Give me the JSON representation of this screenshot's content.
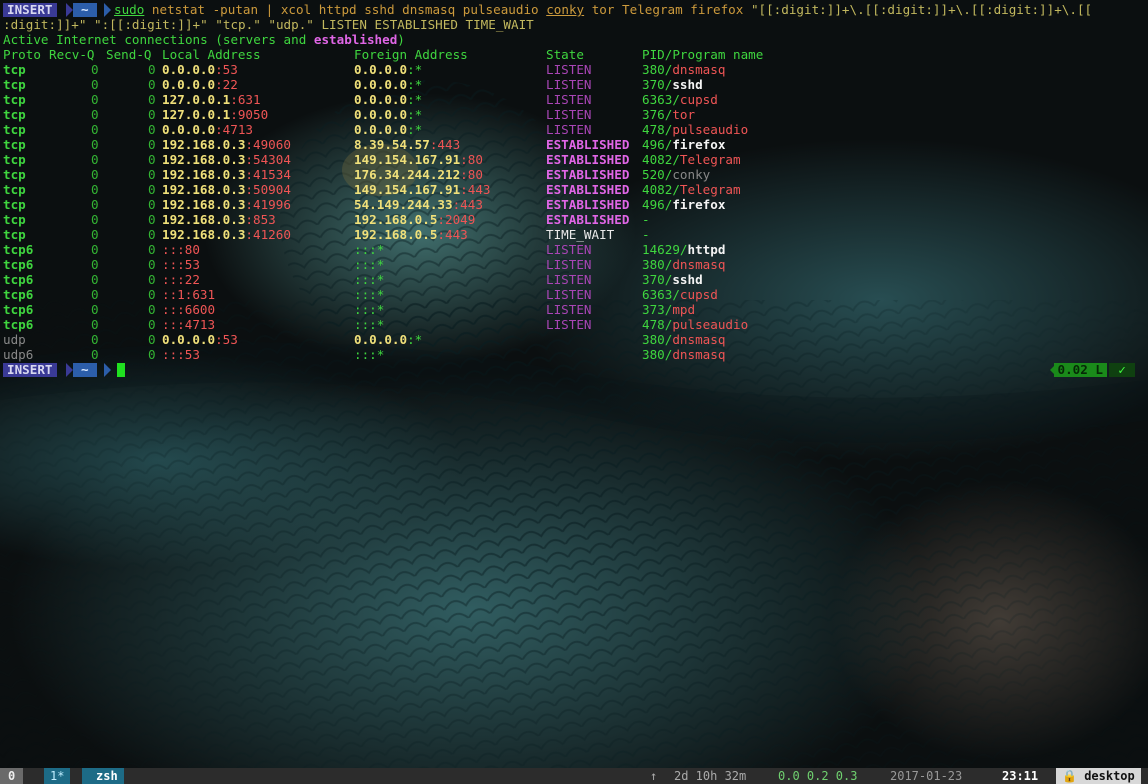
{
  "prompt_top": {
    "mode": "INSERT",
    "dir": "~"
  },
  "command": {
    "sudo": "sudo",
    "rest1": " netstat -putan | xcol httpd sshd dnsmasq pulseaudio ",
    "conky": "conky",
    "rest2": " tor Telegram firefox ",
    "regex1": "\"[[:digit:]]+\\.[[:digit:]]+\\.[[:digit:]]+\\.[[",
    "regex2": ":digit:]]+\"",
    "regex3": " \":[[:digit:]]+\" \"tcp.\" \"udp.\" LISTEN ESTABLISHED TIME_WAIT"
  },
  "header": {
    "active_prefix": "Active Internet connections (servers and ",
    "active_word": "established",
    "active_suffix": ")"
  },
  "columns": [
    "Proto",
    "Recv-Q",
    "Send-Q",
    "Local Address",
    "Foreign Address",
    "State",
    "PID/Program name"
  ],
  "rows": [
    {
      "proto": "tcp",
      "recv": "0",
      "send": "0",
      "lip": "0.0.0.0",
      "lport": ":53",
      "fip": "0.0.0.0",
      "fport": ":*",
      "state": "LISTEN",
      "pid": "380/",
      "prog": "dnsmasq"
    },
    {
      "proto": "tcp",
      "recv": "0",
      "send": "0",
      "lip": "0.0.0.0",
      "lport": ":22",
      "fip": "0.0.0.0",
      "fport": ":*",
      "state": "LISTEN",
      "pid": "370/",
      "prog": "sshd"
    },
    {
      "proto": "tcp",
      "recv": "0",
      "send": "0",
      "lip": "127.0.0.1",
      "lport": ":631",
      "fip": "0.0.0.0",
      "fport": ":*",
      "state": "LISTEN",
      "pid": "6363/",
      "prog": "cupsd"
    },
    {
      "proto": "tcp",
      "recv": "0",
      "send": "0",
      "lip": "127.0.0.1",
      "lport": ":9050",
      "fip": "0.0.0.0",
      "fport": ":*",
      "state": "LISTEN",
      "pid": "376/",
      "prog": "tor"
    },
    {
      "proto": "tcp",
      "recv": "0",
      "send": "0",
      "lip": "0.0.0.0",
      "lport": ":4713",
      "fip": "0.0.0.0",
      "fport": ":*",
      "state": "LISTEN",
      "pid": "478/",
      "prog": "pulseaudio"
    },
    {
      "proto": "tcp",
      "recv": "0",
      "send": "0",
      "lip": "192.168.0.3",
      "lport": ":49060",
      "fip": "8.39.54.57",
      "fport": ":443",
      "state": "ESTABLISHED",
      "pid": "496/",
      "prog": "firefox"
    },
    {
      "proto": "tcp",
      "recv": "0",
      "send": "0",
      "lip": "192.168.0.3",
      "lport": ":54304",
      "fip": "149.154.167.91",
      "fport": ":80",
      "state": "ESTABLISHED",
      "pid": "4082/",
      "prog": "Telegram"
    },
    {
      "proto": "tcp",
      "recv": "0",
      "send": "0",
      "lip": "192.168.0.3",
      "lport": ":41534",
      "fip": "176.34.244.212",
      "fport": ":80",
      "state": "ESTABLISHED",
      "pid": "520/",
      "prog": "conky"
    },
    {
      "proto": "tcp",
      "recv": "0",
      "send": "0",
      "lip": "192.168.0.3",
      "lport": ":50904",
      "fip": "149.154.167.91",
      "fport": ":443",
      "state": "ESTABLISHED",
      "pid": "4082/",
      "prog": "Telegram"
    },
    {
      "proto": "tcp",
      "recv": "0",
      "send": "0",
      "lip": "192.168.0.3",
      "lport": ":41996",
      "fip": "54.149.244.33",
      "fport": ":443",
      "state": "ESTABLISHED",
      "pid": "496/",
      "prog": "firefox"
    },
    {
      "proto": "tcp",
      "recv": "0",
      "send": "0",
      "lip": "192.168.0.3",
      "lport": ":853",
      "fip": "192.168.0.5",
      "fport": ":2049",
      "state": "ESTABLISHED",
      "pid": "-",
      "prog": ""
    },
    {
      "proto": "tcp",
      "recv": "0",
      "send": "0",
      "lip": "192.168.0.3",
      "lport": ":41260",
      "fip": "192.168.0.5",
      "fport": ":443",
      "state": "TIME_WAIT",
      "pid": "-",
      "prog": ""
    },
    {
      "proto": "tcp6",
      "recv": "0",
      "send": "0",
      "lip": ":::",
      "lport": "80",
      "fip": ":::",
      "fport": "*",
      "state": "LISTEN",
      "pid": "14629/",
      "prog": "httpd"
    },
    {
      "proto": "tcp6",
      "recv": "0",
      "send": "0",
      "lip": ":::",
      "lport": "53",
      "fip": ":::",
      "fport": "*",
      "state": "LISTEN",
      "pid": "380/",
      "prog": "dnsmasq"
    },
    {
      "proto": "tcp6",
      "recv": "0",
      "send": "0",
      "lip": ":::",
      "lport": "22",
      "fip": ":::",
      "fport": "*",
      "state": "LISTEN",
      "pid": "370/",
      "prog": "sshd"
    },
    {
      "proto": "tcp6",
      "recv": "0",
      "send": "0",
      "lip": "::1",
      "lport": ":631",
      "fip": ":::",
      "fport": "*",
      "state": "LISTEN",
      "pid": "6363/",
      "prog": "cupsd"
    },
    {
      "proto": "tcp6",
      "recv": "0",
      "send": "0",
      "lip": ":::",
      "lport": "6600",
      "fip": ":::",
      "fport": "*",
      "state": "LISTEN",
      "pid": "373/",
      "prog": "mpd"
    },
    {
      "proto": "tcp6",
      "recv": "0",
      "send": "0",
      "lip": ":::",
      "lport": "4713",
      "fip": ":::",
      "fport": "*",
      "state": "LISTEN",
      "pid": "478/",
      "prog": "pulseaudio"
    },
    {
      "proto": "udp",
      "recv": "0",
      "send": "0",
      "lip": "0.0.0.0",
      "lport": ":53",
      "fip": "0.0.0.0",
      "fport": ":*",
      "state": "",
      "pid": "380/",
      "prog": "dnsmasq"
    },
    {
      "proto": "udp6",
      "recv": "0",
      "send": "0",
      "lip": ":::",
      "lport": "53",
      "fip": ":::",
      "fport": "*",
      "state": "",
      "pid": "380/",
      "prog": "dnsmasq"
    }
  ],
  "prompt_bottom": {
    "mode": "INSERT",
    "dir": "~",
    "load": "0.02 L",
    "ok": "✓"
  },
  "tmux": {
    "session": "0",
    "window_index": "1*",
    "window_name": "zsh",
    "uptime_arrow": "↑",
    "uptime": "2d 10h 32m",
    "load": "0.0 0.2 0.3",
    "date": "2017-01-23",
    "time": "23:11",
    "lock": "🔒",
    "host": "desktop"
  },
  "colors": {
    "tcp": "#3fd63f",
    "listen": "#a845b5",
    "established": "#e066e6",
    "ip": "#f0e07a",
    "port": "#ef5555",
    "insert_badge": "#3a3a96"
  }
}
